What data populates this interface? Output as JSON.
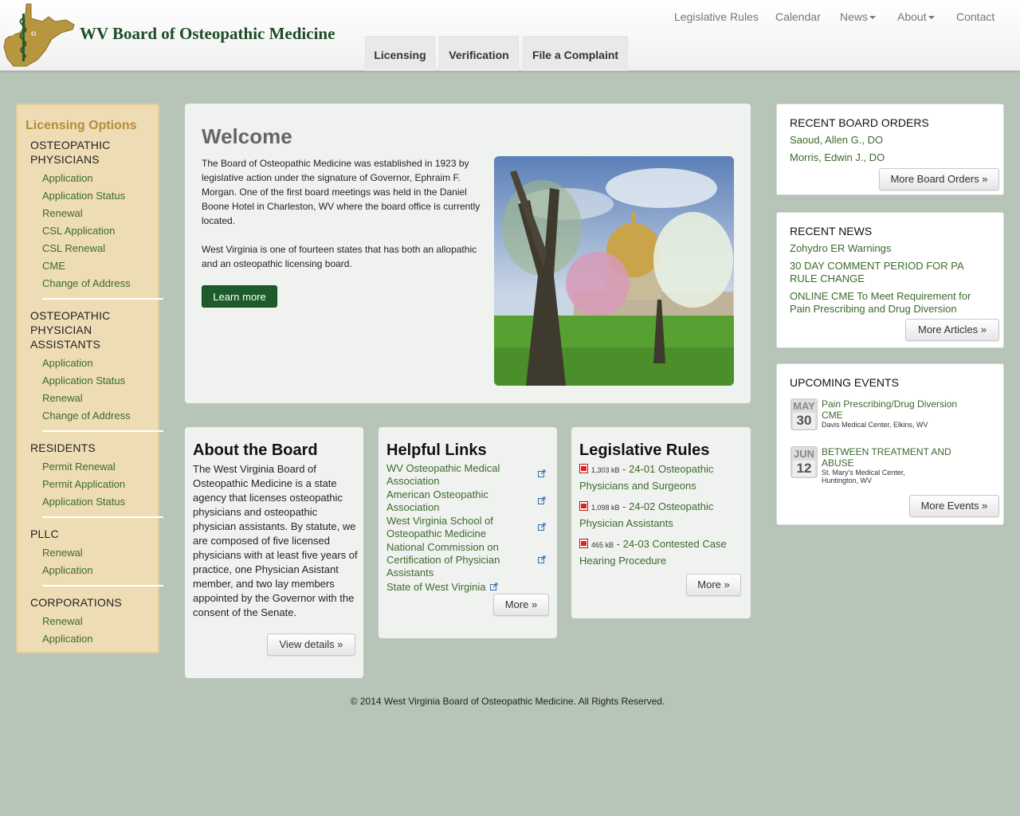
{
  "header": {
    "site_title": "WV Board of Osteopathic Medicine",
    "logo_text": "DO",
    "nav": [
      {
        "label": "Legislative Rules"
      },
      {
        "label": "Calendar"
      },
      {
        "label": "News"
      },
      {
        "label": "About"
      },
      {
        "label": "Contact"
      }
    ],
    "tabs": [
      {
        "label": "Licensing"
      },
      {
        "label": "Verification"
      },
      {
        "label": "File a Complaint"
      }
    ]
  },
  "sidebar": {
    "title": "Licensing Options",
    "sections": [
      {
        "heading": "OSTEOPATHIC PHYSICIANS",
        "links": [
          "Application",
          "Application Status",
          "Renewal",
          "CSL Application",
          "CSL Renewal",
          "CME",
          "Change of Address"
        ]
      },
      {
        "heading": "OSTEOPATHIC PHYSICIAN ASSISTANTS",
        "links": [
          "Application",
          "Application Status",
          "Renewal",
          "Change of Address"
        ]
      },
      {
        "heading": "RESIDENTS",
        "links": [
          "Permit Renewal",
          "Permit Application",
          "Application Status"
        ]
      },
      {
        "heading": "PLLC",
        "links": [
          "Renewal",
          "Application"
        ]
      },
      {
        "heading": "CORPORATIONS",
        "links": [
          "Renewal",
          "Application"
        ]
      }
    ]
  },
  "welcome": {
    "title": "Welcome",
    "para1": "The Board of Osteopathic Medicine was established in 1923 by legislative action under the signature of Governor, Ephraim F. Morgan. One of the first board meetings was held in the Daniel Boone Hotel in Charleston, WV where the board office is currently located.",
    "para2": "West Virginia is one of fourteen states that has both an allopathic and an osteopathic licensing board.",
    "button": "Learn more"
  },
  "about": {
    "title": "About the Board",
    "text": "The West Virginia Board of Osteopathic Medicine is a state agency that licenses osteopathic physicians and osteopathic physician assistants. By statute, we are composed of five licensed physicians with at least five years of practice, one Physician Asistant member, and two lay members appointed by the Governor with the consent of the Senate.",
    "button": "View details »"
  },
  "helpful_links": {
    "title": "Helpful Links",
    "links": [
      "WV Osteopathic Medical Association",
      "American Osteopathic Association",
      "West Virginia School of Osteopathic Medicine",
      "National Commission on Certification of Physician Assistants",
      "State of West Virginia"
    ],
    "button": "More »"
  },
  "leg_rules": {
    "title": "Legislative Rules",
    "items": [
      {
        "size": "1,303 kB",
        "title": "24-01 Osteopathic Physicians and Surgeons"
      },
      {
        "size": "1,098 kB",
        "title": "24-02 Osteopathic Physician Assistants"
      },
      {
        "size": "465 kB",
        "title": "24-03 Contested Case Hearing Procedure"
      }
    ],
    "button": "More »"
  },
  "board_orders": {
    "title": "RECENT BOARD ORDERS",
    "items": [
      "Saoud, Allen G., DO",
      "Morris, Edwin J., DO"
    ],
    "button": "More Board Orders »"
  },
  "news": {
    "title": "RECENT NEWS",
    "items": [
      "Zohydro ER Warnings",
      "30 DAY COMMENT PERIOD FOR PA RULE CHANGE",
      "ONLINE CME To Meet Requirement for Pain Prescribing and Drug Diversion"
    ],
    "button": "More Articles »"
  },
  "events": {
    "title": "UPCOMING EVENTS",
    "items": [
      {
        "month": "MAY",
        "day": "30",
        "title": "Pain Prescribing/Drug Diversion CME",
        "location": "Davis Medical Center, Elkins, WV"
      },
      {
        "month": "JUN",
        "day": "12",
        "title": "BETWEEN TREATMENT AND ABUSE",
        "location": "St. Mary's Medical Center, Huntington, WV"
      }
    ],
    "button": "More Events »"
  },
  "footer": "© 2014 West Virginia Board of Osteopathic Medicine. All Rights Reserved.",
  "colors": {
    "brand_green": "#1d5b2c",
    "link_green": "#3c6a2c",
    "sidebar_bg": "#eeddb4",
    "page_bg": "#b7c5b9"
  }
}
